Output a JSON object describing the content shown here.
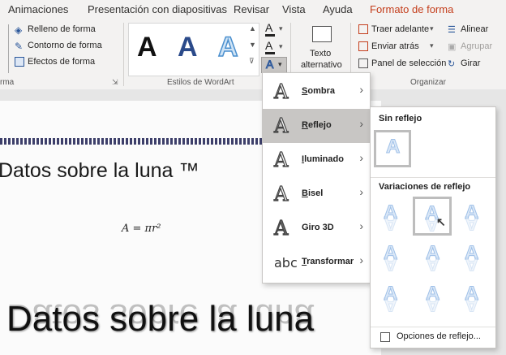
{
  "tabs": [
    {
      "label": "Animaciones",
      "active": false
    },
    {
      "label": "Presentación con diapositivas",
      "active": false
    },
    {
      "label": "Revisar",
      "active": false
    },
    {
      "label": "Vista",
      "active": false
    },
    {
      "label": "Ayuda",
      "active": false
    },
    {
      "label": "Formato de forma",
      "active": true
    }
  ],
  "ribbon": {
    "shape_styles": {
      "fill_label": "Relleno de forma",
      "outline_label": "Contorno de forma",
      "effects_label": "Efectos de forma",
      "group_label": "rma"
    },
    "wordart": {
      "samples": [
        "A",
        "A",
        "A"
      ],
      "group_label": "Estilos de WordArt"
    },
    "alt_text": {
      "line1": "Texto",
      "line2": "alternativo"
    },
    "arrange": {
      "bring_forward": "Traer adelante",
      "send_backward": "Enviar atrás",
      "selection_pane": "Panel de selección",
      "align": "Alinear",
      "group": "Agrupar",
      "rotate": "Girar",
      "group_label": "Organizar"
    }
  },
  "slide": {
    "title_small": "Datos sobre la luna ™",
    "formula": "A = πr²",
    "title_large": "Datos sobre la luna"
  },
  "effects_menu": {
    "items": [
      {
        "label": "Sombra",
        "accel": "S",
        "rest": "ombra",
        "selected": false
      },
      {
        "label": "Reflejo",
        "accel": "R",
        "rest": "eflejo",
        "selected": true
      },
      {
        "label": "Iluminado",
        "accel": "I",
        "rest": "luminado",
        "selected": false
      },
      {
        "label": "Bisel",
        "accel": "B",
        "rest": "isel",
        "selected": false
      },
      {
        "label": "Giro 3D",
        "accel": "",
        "rest": "Giro 3D",
        "selected": false
      },
      {
        "label": "Transformar",
        "accel": "T",
        "rest": "ransformar",
        "selected": false
      }
    ]
  },
  "reflection_submenu": {
    "no_reflection": "Sin reflejo",
    "variations": "Variaciones de reflejo",
    "options": "Opciones de reflejo...",
    "variation_glyph": "A"
  }
}
